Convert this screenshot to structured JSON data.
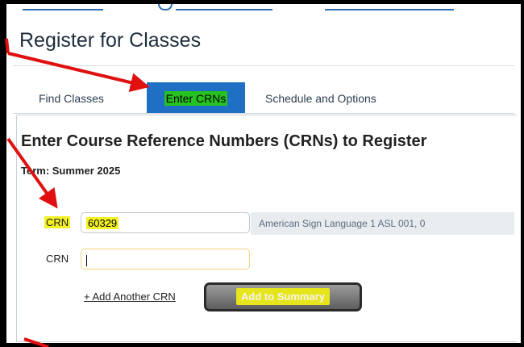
{
  "page": {
    "title": "Register for Classes"
  },
  "tabs": [
    {
      "label": "Find Classes"
    },
    {
      "label": "Enter CRNs"
    },
    {
      "label": "Schedule and Options"
    }
  ],
  "panel": {
    "heading": "Enter Course Reference Numbers (CRNs) to Register",
    "term": "Term: Summer 2025"
  },
  "crn_rows": [
    {
      "label": "CRN",
      "value": "60329",
      "course_info": "American Sign Language 1 ASL 001, 0"
    },
    {
      "label": "CRN",
      "value": ""
    }
  ],
  "actions": {
    "add_another": "+ Add Another CRN",
    "add_to_summary": "Add to Summary"
  },
  "colors": {
    "highlight_yellow": "#f4f125",
    "active_tab_blue": "#1f6fc4",
    "active_tab_text_highlight": "#27c21f",
    "annotation_red": "#e01010"
  }
}
